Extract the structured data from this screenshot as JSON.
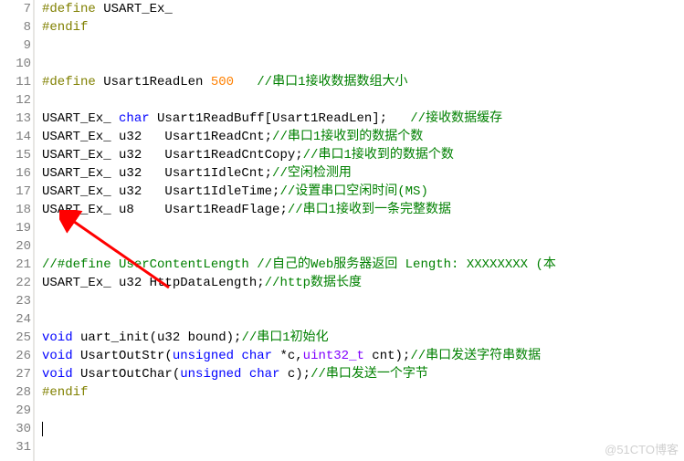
{
  "gutter": {
    "start": 7,
    "end": 31
  },
  "lines": {
    "7": {
      "pp": "#define",
      "rest": " USART_Ex_"
    },
    "8": {
      "pp": "#endif"
    },
    "9": {},
    "10": {},
    "11": {
      "pp": "#define",
      "id": " Usart1ReadLen ",
      "num": "500",
      "sp": "   ",
      "cm": "//串口1接收数据数组大小"
    },
    "12": {},
    "13": {
      "id1": "USART_Ex_ ",
      "kw": "char",
      "id2": " Usart1ReadBuff[Usart1ReadLen];   ",
      "cm": "//接收数据缓存"
    },
    "14": {
      "id1": "USART_Ex_ u32   Usart1ReadCnt;",
      "cm": "//串口1接收到的数据个数"
    },
    "15": {
      "id1": "USART_Ex_ u32   Usart1ReadCntCopy;",
      "cm": "//串口1接收到的数据个数"
    },
    "16": {
      "id1": "USART_Ex_ u32   Usart1IdleCnt;",
      "cm": "//空闲检测用"
    },
    "17": {
      "id1": "USART_Ex_ u32   Usart1IdleTime;",
      "cm": "//设置串口空闲时间(MS)"
    },
    "18": {
      "id1": "USART_Ex_ u8    Usart1ReadFlage;",
      "cm": "//串口1接收到一条完整数据"
    },
    "19": {},
    "20": {},
    "21": {
      "cm": "//#define UserContentLength //自己的Web服务器返回 Length: XXXXXXXX (本"
    },
    "22": {
      "id1": "USART_Ex_ u32 HttpDataLength;",
      "cm": "//http数据长度"
    },
    "23": {},
    "24": {},
    "25": {
      "kw": "void",
      "id1": " uart_init(u32 bound);",
      "cm": "//串口1初始化"
    },
    "26": {
      "kw": "void",
      "id1": " UsartOutStr(",
      "kw2": "unsigned",
      "sp2": " ",
      "kw3": "char",
      "id2": " *c,",
      "typ": "uint32_t",
      "id3": " cnt);",
      "cm": "//串口发送字符串数据"
    },
    "27": {
      "kw": "void",
      "id1": " UsartOutChar(",
      "kw2": "unsigned",
      "sp2": " ",
      "kw3": "char",
      "id2": " c);",
      "cm": "//串口发送一个字节"
    },
    "28": {
      "pp": "#endif"
    },
    "29": {},
    "30": {
      "cursor": true
    },
    "31": {}
  },
  "watermark": "@51CTO博客"
}
